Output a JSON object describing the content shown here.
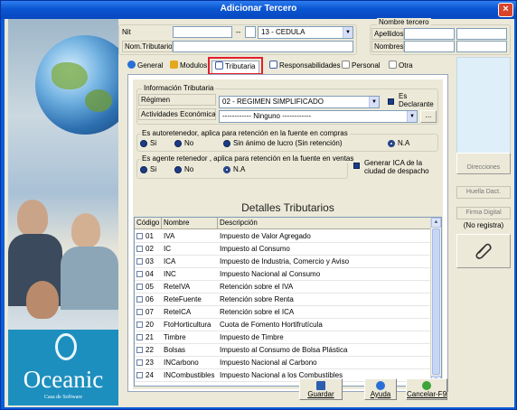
{
  "window": {
    "title": "Adicionar Tercero",
    "close_label": "×"
  },
  "header": {
    "nit_label": "Nit",
    "nit_value": "",
    "dash": "--",
    "dv_value": "",
    "doc_type": "13 - CEDULA",
    "nom_tributario_label": "Nom.Tributario",
    "nom_tributario_value": "",
    "nombre_tercero_label": "Nombre tercero",
    "apellidos_label": "Apellidos",
    "nombres_label": "Nombres"
  },
  "tabs": [
    {
      "label": "General",
      "active": false
    },
    {
      "label": "Modulos",
      "active": false
    },
    {
      "label": "Tributaria",
      "active": true
    },
    {
      "label": "Responsabilidades",
      "active": false
    },
    {
      "label": "Personal",
      "active": false
    },
    {
      "label": "Otra",
      "active": false
    }
  ],
  "tributaria": {
    "info_title": "Información Tributaria",
    "regimen_label": "Régimen",
    "regimen_value": "02 - REGIMEN SIMPLIFICADO",
    "declarante_label": "Es Declarante",
    "actividades_label": "Actividades Económicas",
    "actividades_value": "------------ Ninguno ------------",
    "browse_label": "...",
    "autoretenedor_title": "Es autoretenedor, aplica para retención en la fuente en compras",
    "autoretenedor_options": [
      "Si",
      "No",
      "Sin ánimo de lucro (Sin retención)",
      "N.A"
    ],
    "agente_title": "Es agente retenedor , aplica para retención en la fuente en ventas",
    "agente_options": [
      "Si",
      "No",
      "N.A"
    ],
    "ica_label": "Generar ICA de la ciudad de despacho"
  },
  "details": {
    "title": "Detalles Tributarios",
    "columns": [
      "Código",
      "Nombre",
      "Descripción"
    ],
    "rows": [
      {
        "code": "01",
        "name": "IVA",
        "desc": "Impuesto de Valor Agregado"
      },
      {
        "code": "02",
        "name": "IC",
        "desc": "Impuesto al Consumo"
      },
      {
        "code": "03",
        "name": "ICA",
        "desc": "Impuesto de Industria, Comercio y Aviso"
      },
      {
        "code": "04",
        "name": "INC",
        "desc": "Impuesto Nacional al Consumo"
      },
      {
        "code": "05",
        "name": "ReteIVA",
        "desc": "Retención sobre el IVA"
      },
      {
        "code": "06",
        "name": "ReteFuente",
        "desc": "Retención sobre Renta"
      },
      {
        "code": "07",
        "name": "ReteICA",
        "desc": "Retención sobre el ICA"
      },
      {
        "code": "20",
        "name": "FtoHorticultura",
        "desc": "Cuota de Fomento Hortifrutícula"
      },
      {
        "code": "21",
        "name": "Timbre",
        "desc": "Impuesto de Timbre"
      },
      {
        "code": "22",
        "name": "Bolsas",
        "desc": "Impuesto al Consumo de Bolsa Plástica"
      },
      {
        "code": "23",
        "name": "INCarbono",
        "desc": "Impuesto Nacional al Carbono"
      },
      {
        "code": "24",
        "name": "INCombustibles",
        "desc": "Impuesto Nacional a los Combustibles"
      }
    ]
  },
  "side": {
    "direcciones_label": "Direcciones",
    "huella_label": "Huella Dact.",
    "firma_label": "Firma Digital",
    "no_registra": "(No registra)"
  },
  "buttons": {
    "guardar": "Guardar",
    "ayuda": "Ayuda",
    "cancelar": "Cancelar-F9"
  },
  "logo": {
    "name": "Oceanic",
    "tagline": "Casa de Software"
  }
}
